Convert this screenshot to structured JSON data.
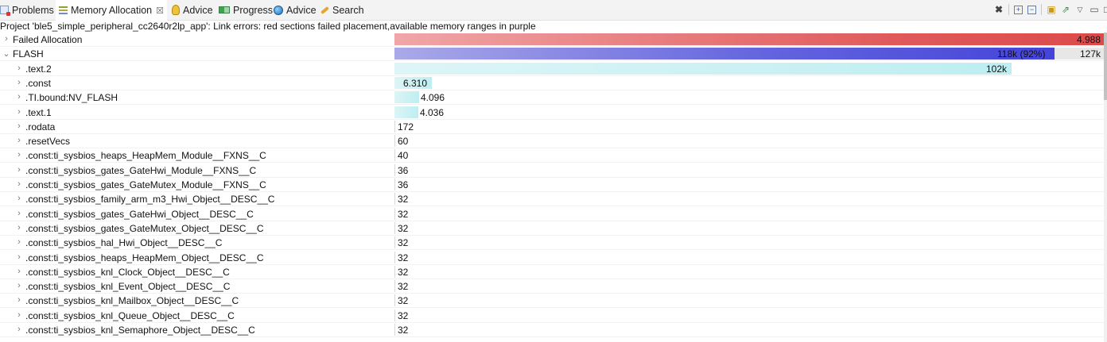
{
  "tabs": [
    {
      "label": "Problems",
      "icon": "problems-icon",
      "active": false
    },
    {
      "label": "Memory Allocation",
      "icon": "memory-allocation-icon",
      "active": true,
      "close": "☒"
    },
    {
      "label": "Advice",
      "icon": "lightbulb-icon",
      "active": false
    },
    {
      "label": "Progress",
      "icon": "progress-icon",
      "active": false
    },
    {
      "label": "Advice",
      "icon": "globe-icon",
      "active": false
    },
    {
      "label": "Search",
      "icon": "search-icon",
      "active": false
    }
  ],
  "toolbar_icons": [
    "remove-all-icon",
    "expand-all-icon",
    "collapse-all-icon",
    "new-view-icon",
    "export-icon",
    "view-menu-icon",
    "minimize-icon",
    "maximize-icon"
  ],
  "status_text": "Project 'ble5_simple_peripheral_cc2640r2lp_app': Link errors: red sections failed placement,available memory ranges in purple",
  "tree": [
    {
      "label": "Failed Allocation",
      "expander": "›",
      "value": "4.988",
      "kind": "failed",
      "fraction": 1.0
    },
    {
      "label": "FLASH",
      "expander": "⌄",
      "value": "118k (92%)",
      "capacity": "127k",
      "kind": "flash",
      "fraction": 0.92
    },
    {
      "label": ".text.2",
      "expander": "›",
      "value": "102k",
      "kind": "section",
      "fraction": 0.868
    },
    {
      "label": ".const",
      "expander": "›",
      "value": "6.310",
      "kind": "section",
      "fraction": 0.053
    },
    {
      "label": ".TI.bound:NV_FLASH",
      "expander": "›",
      "value": "4.096",
      "kind": "section",
      "fraction": 0.035
    },
    {
      "label": ".text.1",
      "expander": "›",
      "value": "4.036",
      "kind": "section",
      "fraction": 0.034
    },
    {
      "label": ".rodata",
      "expander": "›",
      "value": "172",
      "kind": "tiny",
      "fraction": 0.0015
    },
    {
      "label": ".resetVecs",
      "expander": "›",
      "value": "60",
      "kind": "tiny",
      "fraction": 0.0005
    },
    {
      "label": ".const:ti_sysbios_heaps_HeapMem_Module__FXNS__C",
      "expander": "›",
      "value": "40",
      "kind": "tiny",
      "fraction": 0.0003
    },
    {
      "label": ".const:ti_sysbios_gates_GateHwi_Module__FXNS__C",
      "expander": "›",
      "value": "36",
      "kind": "tiny",
      "fraction": 0.0003
    },
    {
      "label": ".const:ti_sysbios_gates_GateMutex_Module__FXNS__C",
      "expander": "›",
      "value": "36",
      "kind": "tiny",
      "fraction": 0.0003
    },
    {
      "label": ".const:ti_sysbios_family_arm_m3_Hwi_Object__DESC__C",
      "expander": "›",
      "value": "32",
      "kind": "tiny",
      "fraction": 0.0003
    },
    {
      "label": ".const:ti_sysbios_gates_GateHwi_Object__DESC__C",
      "expander": "›",
      "value": "32",
      "kind": "tiny",
      "fraction": 0.0003
    },
    {
      "label": ".const:ti_sysbios_gates_GateMutex_Object__DESC__C",
      "expander": "›",
      "value": "32",
      "kind": "tiny",
      "fraction": 0.0003
    },
    {
      "label": ".const:ti_sysbios_hal_Hwi_Object__DESC__C",
      "expander": "›",
      "value": "32",
      "kind": "tiny",
      "fraction": 0.0003
    },
    {
      "label": ".const:ti_sysbios_heaps_HeapMem_Object__DESC__C",
      "expander": "›",
      "value": "32",
      "kind": "tiny",
      "fraction": 0.0003
    },
    {
      "label": ".const:ti_sysbios_knl_Clock_Object__DESC__C",
      "expander": "›",
      "value": "32",
      "kind": "tiny",
      "fraction": 0.0003
    },
    {
      "label": ".const:ti_sysbios_knl_Event_Object__DESC__C",
      "expander": "›",
      "value": "32",
      "kind": "tiny",
      "fraction": 0.0003
    },
    {
      "label": ".const:ti_sysbios_knl_Mailbox_Object__DESC__C",
      "expander": "›",
      "value": "32",
      "kind": "tiny",
      "fraction": 0.0003
    },
    {
      "label": ".const:ti_sysbios_knl_Queue_Object__DESC__C",
      "expander": "›",
      "value": "32",
      "kind": "tiny",
      "fraction": 0.0003
    },
    {
      "label": ".const:ti_sysbios_knl_Semaphore_Object__DESC__C",
      "expander": "›",
      "value": "32",
      "kind": "tiny",
      "fraction": 0.0003
    }
  ]
}
